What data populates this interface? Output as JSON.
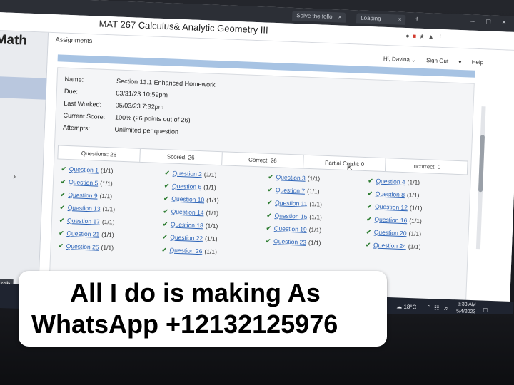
{
  "browser": {
    "tabs": [
      "Solve the follo",
      "Loading"
    ],
    "close_glyph": "×",
    "new_tab_glyph": "+"
  },
  "app": {
    "logo": "Math",
    "course_title": "MAT 267 Calculus& Analytic Geometry III",
    "assignments_tab": "Assignments",
    "user_greeting": "Hi, Davina ⌄",
    "sign_out": "Sign Out",
    "help": "Help",
    "sidebar_arrow": "›",
    "search_label": "search"
  },
  "assignment": {
    "name_label": "Name:",
    "name": "Section 13.1 Enhanced Homework",
    "due_label": "Due:",
    "due": "03/31/23 10:59pm",
    "last_worked_label": "Last Worked:",
    "last_worked": "05/03/23 7:32pm",
    "score_label": "Current Score:",
    "score": "100% (26 points out of 26)",
    "attempts_label": "Attempts:",
    "attempts": "Unlimited per question"
  },
  "stats": {
    "questions": "Questions: 26",
    "scored": "Scored: 26",
    "correct": "Correct: 26",
    "partial": "Partial Credit: 0",
    "incorrect": "Incorrect: 0"
  },
  "questions": {
    "columns": [
      [
        {
          "label": "Question 1",
          "score": "(1/1)"
        },
        {
          "label": "Question 5",
          "score": "(1/1)"
        },
        {
          "label": "Question 9",
          "score": "(1/1)"
        },
        {
          "label": "Question 13",
          "score": "(1/1)"
        },
        {
          "label": "Question 17",
          "score": "(1/1)"
        },
        {
          "label": "Question 21",
          "score": "(1/1)"
        },
        {
          "label": "Question 25",
          "score": "(1/1)"
        }
      ],
      [
        {
          "label": "Question 2",
          "score": "(1/1)"
        },
        {
          "label": "Question 6",
          "score": "(1/1)"
        },
        {
          "label": "Question 10",
          "score": "(1/1)"
        },
        {
          "label": "Question 14",
          "score": "(1/1)"
        },
        {
          "label": "Question 18",
          "score": "(1/1)"
        },
        {
          "label": "Question 22",
          "score": "(1/1)"
        },
        {
          "label": "Question 26",
          "score": "(1/1)"
        }
      ],
      [
        {
          "label": "Question 3",
          "score": "(1/1)"
        },
        {
          "label": "Question 7",
          "score": "(1/1)"
        },
        {
          "label": "Question 11",
          "score": "(1/1)"
        },
        {
          "label": "Question 15",
          "score": "(1/1)"
        },
        {
          "label": "Question 19",
          "score": "(1/1)"
        },
        {
          "label": "Question 23",
          "score": "(1/1)"
        }
      ],
      [
        {
          "label": "Question 4",
          "score": "(1/1)"
        },
        {
          "label": "Question 8",
          "score": "(1/1)"
        },
        {
          "label": "Question 12",
          "score": "(1/1)"
        },
        {
          "label": "Question 16",
          "score": "(1/1)"
        },
        {
          "label": "Question 20",
          "score": "(1/1)"
        },
        {
          "label": "Question 24",
          "score": "(1/1)"
        }
      ]
    ]
  },
  "taskbar": {
    "temperature": "18°C",
    "time": "3:33 AM",
    "date": "5/4/2023"
  },
  "caption": {
    "line1": "All I do is making As",
    "line2": "WhatsApp +12132125976"
  },
  "icons": {
    "check": "check-icon",
    "cursor": "mouse-cursor-icon",
    "bell": "bell-icon",
    "weather": "cloud-icon",
    "notification": "notification-icon"
  },
  "colors": {
    "link": "#2b63b8",
    "check": "#2e7d32",
    "accent_bar": "#a7c3e3",
    "taskbar": "#1f2430"
  }
}
